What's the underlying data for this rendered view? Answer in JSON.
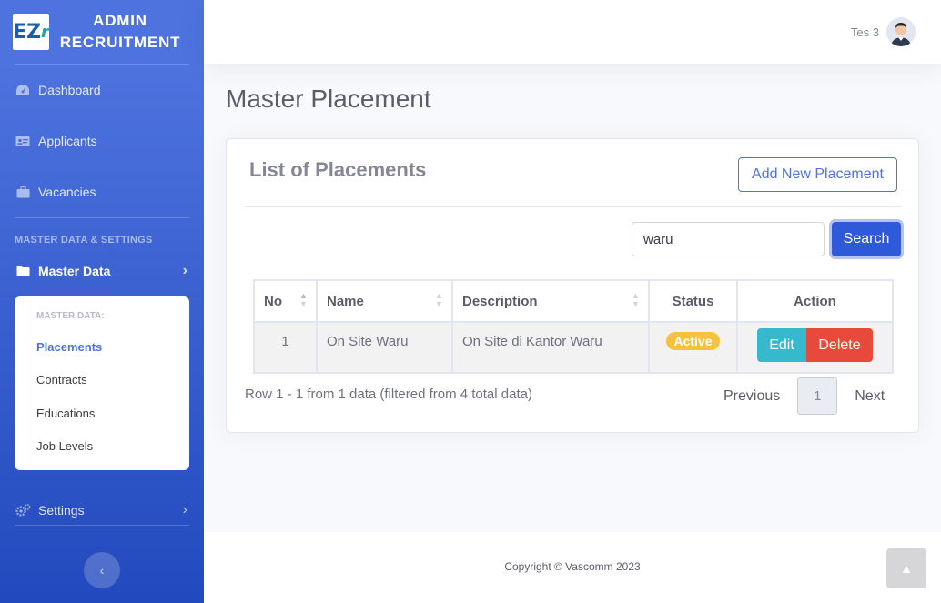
{
  "brand": {
    "logo_text": "EZ",
    "logo_suffix": "r",
    "line1": "ADMIN",
    "line2": "RECRUITMENT"
  },
  "sidebar": {
    "items": [
      {
        "label": "Dashboard",
        "icon": "tachometer-icon"
      },
      {
        "label": "Applicants",
        "icon": "id-card-icon"
      },
      {
        "label": "Vacancies",
        "icon": "briefcase-icon"
      }
    ],
    "heading": "MASTER DATA & SETTINGS",
    "master_data": {
      "label": "Master Data",
      "icon": "folder-icon"
    },
    "submenu": {
      "header": "MASTER DATA:",
      "items": [
        "Placements",
        "Contracts",
        "Educations",
        "Job Levels"
      ],
      "active": "Placements"
    },
    "settings": {
      "label": "Settings",
      "icon": "cogs-icon"
    }
  },
  "topbar": {
    "user_name": "Tes 3"
  },
  "page": {
    "title": "Master Placement"
  },
  "card": {
    "title": "List of Placements",
    "add_button": "Add New Placement",
    "search": {
      "value": "waru",
      "button": "Search"
    }
  },
  "table": {
    "headers": [
      "No",
      "Name",
      "Description",
      "Status",
      "Action"
    ],
    "rows": [
      {
        "no": "1",
        "name": "On Site Waru",
        "description": "On Site di Kantor Waru",
        "status": "Active",
        "edit": "Edit",
        "delete": "Delete"
      }
    ]
  },
  "pagination": {
    "info": "Row 1 - 1 from 1 data (filtered from 4 total data)",
    "previous": "Previous",
    "current": "1",
    "next": "Next"
  },
  "footer": {
    "copyright": "Copyright © Vascomm 2023"
  },
  "colors": {
    "primary": "#4e73df",
    "info": "#36b9cc",
    "danger": "#e74a3b",
    "warning": "#f6c23e"
  }
}
